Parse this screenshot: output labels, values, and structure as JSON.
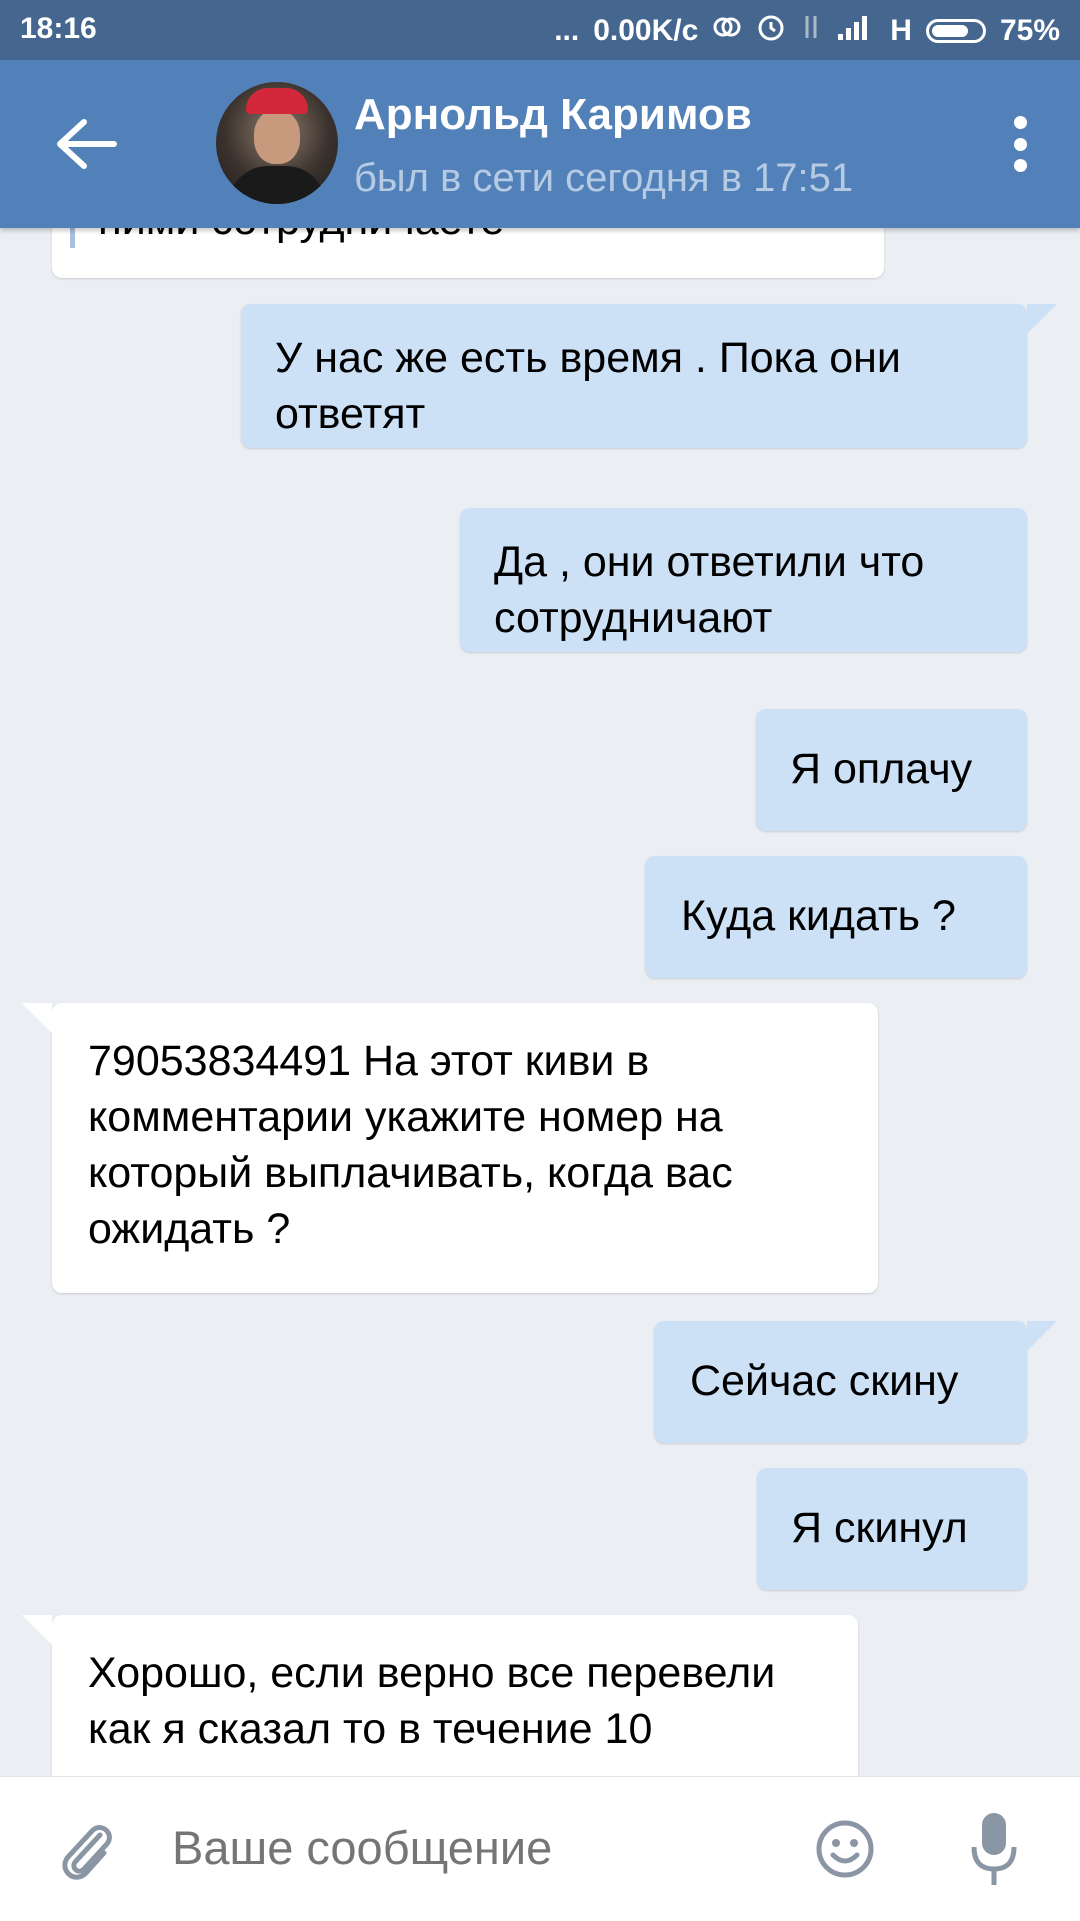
{
  "status_bar": {
    "time": "18:16",
    "dots": "...",
    "speed": "0.00K/c",
    "network": "H",
    "battery": "75%",
    "battery_level": 0.75
  },
  "header": {
    "name": "Арнольд Каримов",
    "status": "был в сети сегодня в 17:51",
    "accent": "#5181b8"
  },
  "messages": [
    {
      "direction": "in",
      "text": "ними сотрудничаете"
    },
    {
      "direction": "out",
      "text": "У нас же есть время . Пока они ответят"
    },
    {
      "direction": "out",
      "text": "Да , они ответили что сотрудничают"
    },
    {
      "direction": "out",
      "text": "Я оплачу"
    },
    {
      "direction": "out",
      "text": "Куда кидать ?"
    },
    {
      "direction": "in",
      "text": "79053834491 На этот киви в комментарии укажите номер на который выплачивать, когда вас ожидать ?"
    },
    {
      "direction": "out",
      "text": "Сейчас скину"
    },
    {
      "direction": "out",
      "text": "Я скинул"
    },
    {
      "direction": "in",
      "text": "Хорошо, если верно все перевели как я сказал то в течение 10"
    }
  ],
  "composer": {
    "placeholder": "Ваше сообщение"
  },
  "icons": {
    "back": "arrow-left-icon",
    "menu": "more-vert-icon",
    "attach": "paperclip-icon",
    "emoji": "smile-icon",
    "voice": "microphone-icon"
  }
}
